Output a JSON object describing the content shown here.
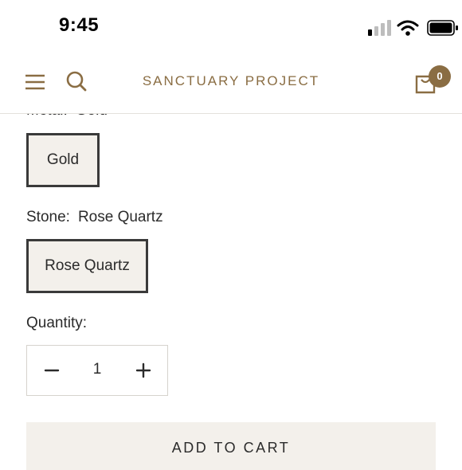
{
  "status_bar": {
    "time": "9:45",
    "icons": [
      "signal-icon",
      "wifi-icon",
      "battery-icon"
    ]
  },
  "header": {
    "brand": "SANCTUARY PROJECT",
    "cart_count": "0",
    "icons": [
      "menu-icon",
      "search-icon",
      "cart-icon"
    ],
    "accent_color": "#8a6d43"
  },
  "options": {
    "metal": {
      "label": "Metal:",
      "selected": "Gold",
      "choices": [
        "Gold"
      ]
    },
    "stone": {
      "label": "Stone:",
      "selected": "Rose Quartz",
      "choices": [
        "Rose Quartz"
      ]
    }
  },
  "quantity": {
    "label": "Quantity:",
    "value": "1",
    "icons": [
      "minus-icon",
      "plus-icon"
    ]
  },
  "add_to_cart": {
    "label": "ADD TO CART"
  }
}
